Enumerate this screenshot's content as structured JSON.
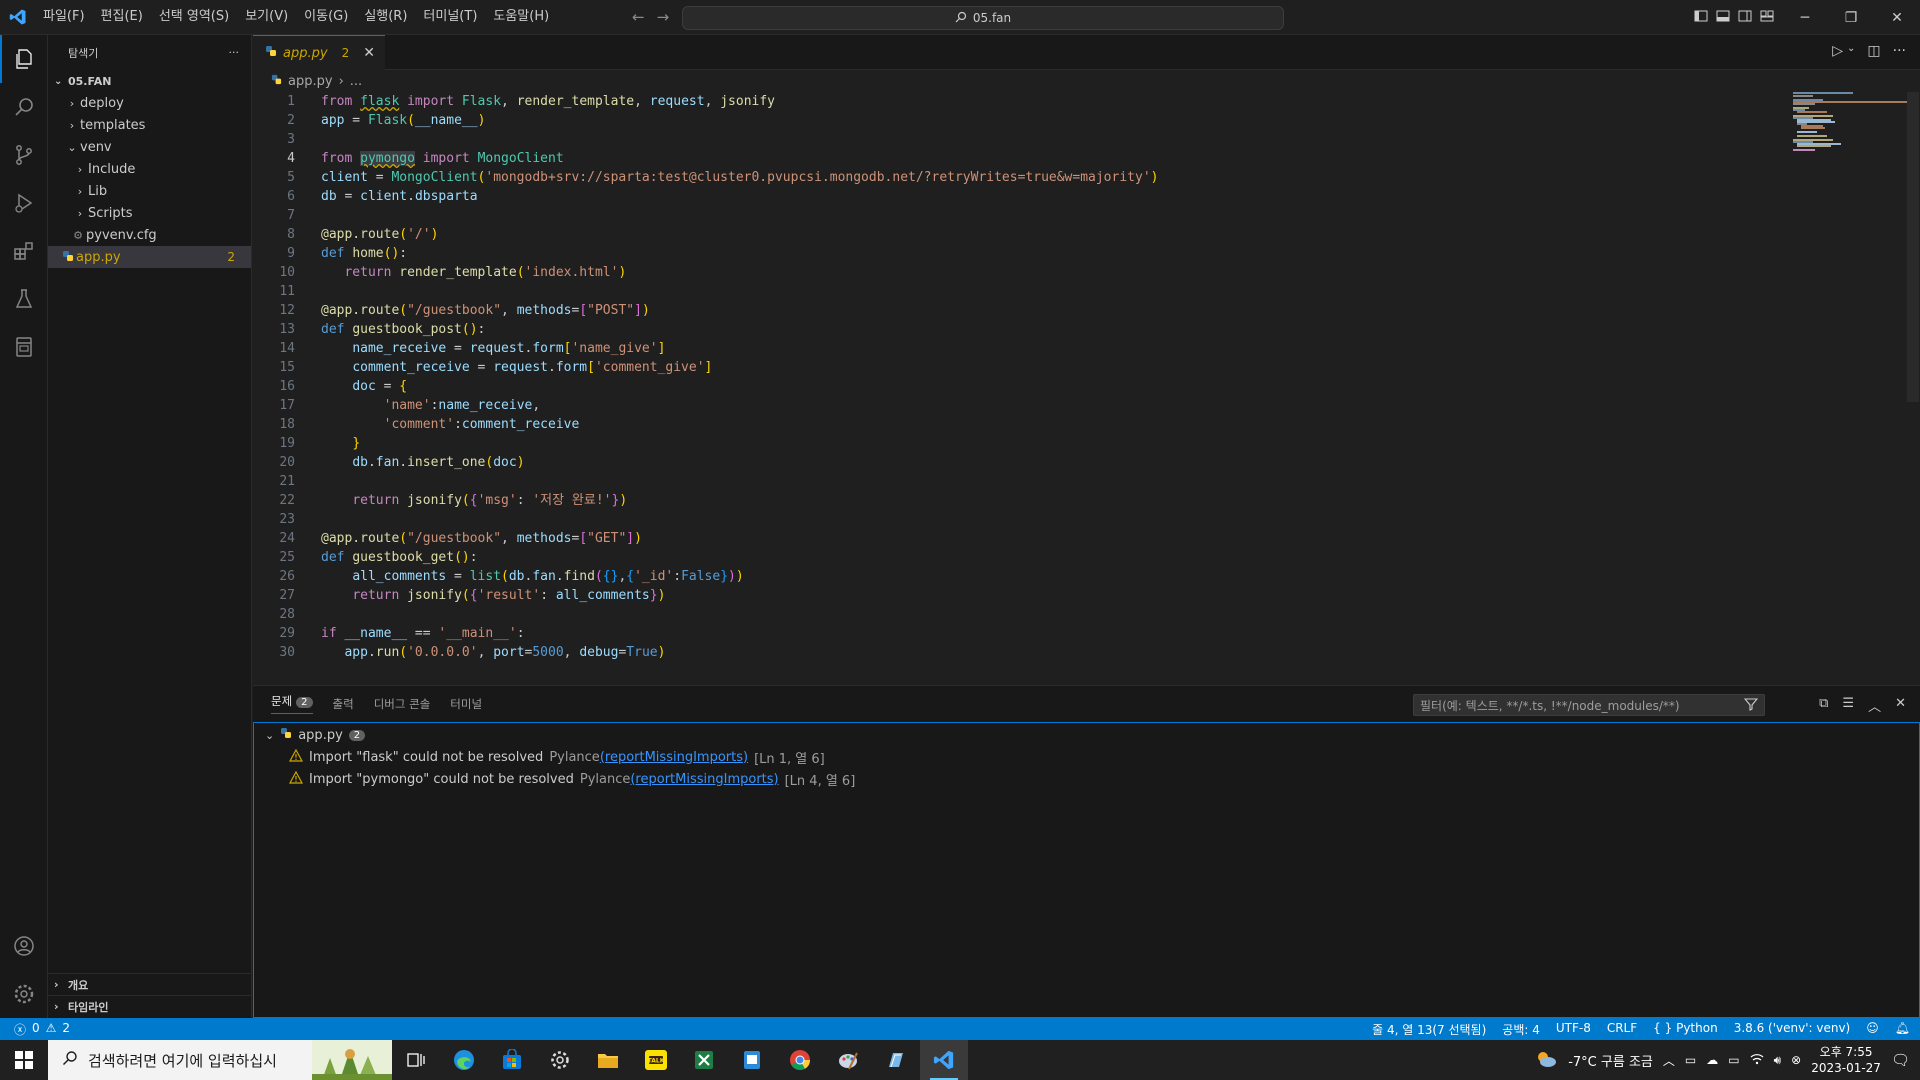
{
  "titlebar": {
    "menus": [
      "파일(F)",
      "편집(E)",
      "선택 영역(S)",
      "보기(V)",
      "이동(G)",
      "실행(R)",
      "터미널(T)",
      "도움말(H)"
    ],
    "search_text": "05.fan"
  },
  "sidebar": {
    "title": "탐색기",
    "more": "···",
    "root": "05.FAN",
    "items": [
      {
        "label": "deploy",
        "chev": "›"
      },
      {
        "label": "templates",
        "chev": "›"
      },
      {
        "label": "venv",
        "chev": "⌄"
      },
      {
        "label": "Include",
        "chev": "›"
      },
      {
        "label": "Lib",
        "chev": "›"
      },
      {
        "label": "Scripts",
        "chev": "›"
      },
      {
        "label": "pyvenv.cfg"
      },
      {
        "label": "app.py",
        "badge": "2"
      }
    ],
    "outline": "개요",
    "timeline": "타임라인"
  },
  "editor": {
    "tab_name": "app.py",
    "tab_count": "2",
    "breadcrumb_file": "app.py",
    "breadcrumb_more": "...",
    "active_line": 4
  },
  "panel": {
    "tabs": [
      "문제",
      "출력",
      "디버그 콘솔",
      "터미널"
    ],
    "problems_count": "2",
    "filter_placeholder": "필터(예: 텍스트, **/*.ts, !**/node_modules/**)",
    "group_file": "app.py",
    "group_count": "2",
    "problems": [
      {
        "msg": "Import \"flask\" could not be resolved",
        "source": "Pylance",
        "code": "(reportMissingImports)",
        "loc": "[Ln 1, 열 6]"
      },
      {
        "msg": "Import \"pymongo\" could not be resolved",
        "source": "Pylance",
        "code": "(reportMissingImports)",
        "loc": "[Ln 4, 열 6]"
      }
    ]
  },
  "statusbar": {
    "errors": "0",
    "warnings": "2",
    "cursor": "줄 4, 열 13(7 선택됨)",
    "spaces": "공백: 4",
    "encoding": "UTF-8",
    "eol": "CRLF",
    "language": "Python",
    "interpreter": "3.8.6 ('venv': venv)"
  },
  "taskbar": {
    "search_placeholder": "검색하려면 여기에 입력하십시",
    "weather": "-7°C  구름 조금",
    "time": "오후 7:55",
    "date": "2023-01-27"
  },
  "colors": {
    "accent": "#0078d4",
    "statusbar": "#007acc",
    "warning": "#cca700"
  }
}
